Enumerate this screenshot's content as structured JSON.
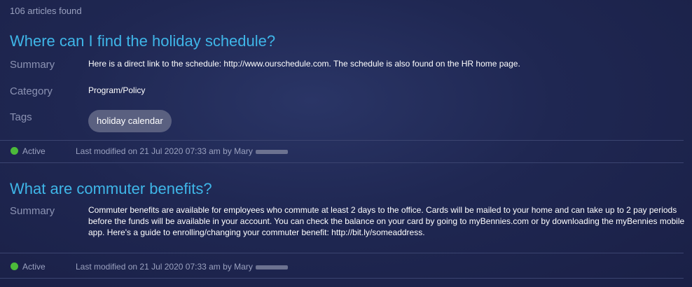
{
  "results": {
    "count_text": "106 articles found"
  },
  "labels": {
    "summary": "Summary",
    "category": "Category",
    "tags": "Tags"
  },
  "articles": [
    {
      "title": "Where can I find the holiday schedule?",
      "summary": "Here is a direct link to the schedule: http://www.ourschedule.com. The schedule is also found on the HR home page.",
      "category": "Program/Policy",
      "tags": [
        "holiday calendar"
      ],
      "status": "Active",
      "modified": "Last modified on 21 Jul 2020 07:33 am by Mary",
      "status_color": "#4cba3a"
    },
    {
      "title": "What are commuter benefits?",
      "summary": "Commuter benefits are available for employees who commute at least 2 days to the office. Cards will be mailed to your home and can take up to 2 pay periods before the funds will be available in your account. You can check the balance on your card by going to myBennies.com or by downloading the myBennies mobile app. Here's a guide to enrolling/changing your commuter benefit: http://bit.ly/someaddress.",
      "status": "Active",
      "modified": "Last modified on 21 Jul 2020 07:33 am by Mary",
      "status_color": "#4cba3a"
    }
  ],
  "colors": {
    "title": "#3fb6e8",
    "label": "#8c93b3",
    "tag_bg": "#5a6080",
    "background": "#1f2752"
  }
}
